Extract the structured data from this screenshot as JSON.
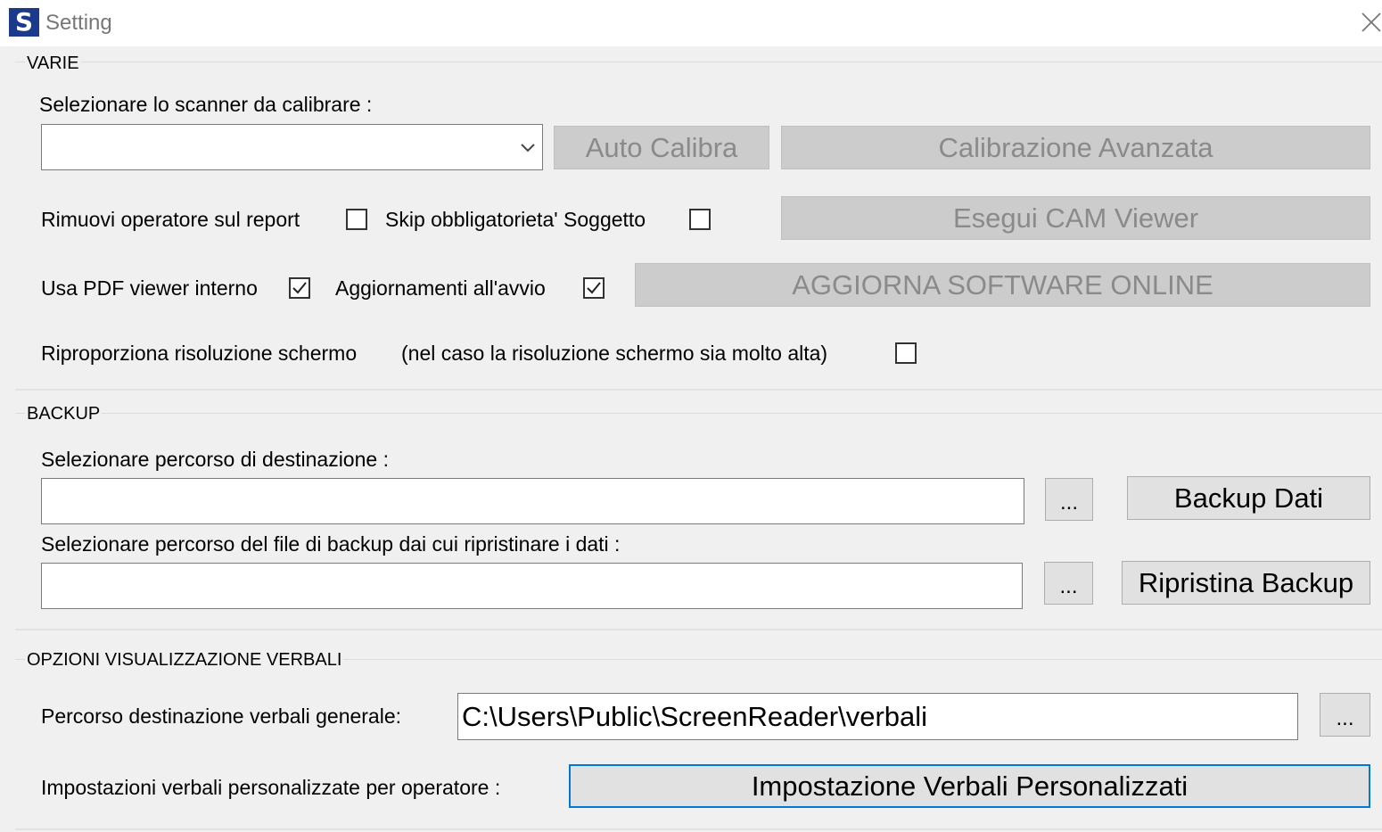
{
  "window": {
    "title": "Setting",
    "icon_letter": "S",
    "icon_color": "#1c3a8c"
  },
  "varie": {
    "group_title": "VARIE",
    "scanner_label": "Selezionare lo scanner da calibrare :",
    "scanner_value": "",
    "auto_calibra": "Auto Calibra",
    "calibrazione_avanzata": "Calibrazione Avanzata",
    "rimuovi_operatore": "Rimuovi operatore sul report",
    "rimuovi_operatore_checked": false,
    "skip_obbligatorieta": "Skip obbligatorieta' Soggetto",
    "skip_obbligatorieta_checked": false,
    "esegui_cam_viewer": "Esegui CAM Viewer",
    "usa_pdf_viewer": "Usa PDF viewer interno",
    "usa_pdf_viewer_checked": true,
    "aggiornamenti_avvio": "Aggiornamenti all'avvio",
    "aggiornamenti_avvio_checked": true,
    "aggiorna_software": "AGGIORNA SOFTWARE ONLINE",
    "riproporziona": "Riproporziona risoluzione schermo",
    "riproporziona_note": "(nel caso la risoluzione schermo sia molto alta)",
    "riproporziona_checked": false
  },
  "backup": {
    "group_title": "BACKUP",
    "destinazione_label": "Selezionare percorso di destinazione :",
    "destinazione_value": "",
    "browse_label": "...",
    "backup_dati": "Backup Dati",
    "ripristino_label": "Selezionare percorso del file di backup dai cui ripristinare i dati :",
    "ripristino_value": "",
    "ripristina_backup": "Ripristina Backup"
  },
  "verbali": {
    "group_title": "OPZIONI VISUALIZZAZIONE VERBALI",
    "percorso_label": "Percorso destinazione verbali generale:",
    "percorso_value": "C:\\Users\\Public\\ScreenReader\\verbali",
    "browse_label": "...",
    "impostazioni_label": "Impostazioni verbali personalizzate per operatore :",
    "impostazione_button": "Impostazione Verbali Personalizzati"
  },
  "colors": {
    "background": "#f0f0f0",
    "disabled_button": "#cccccc",
    "focus_border": "#0078d7"
  }
}
